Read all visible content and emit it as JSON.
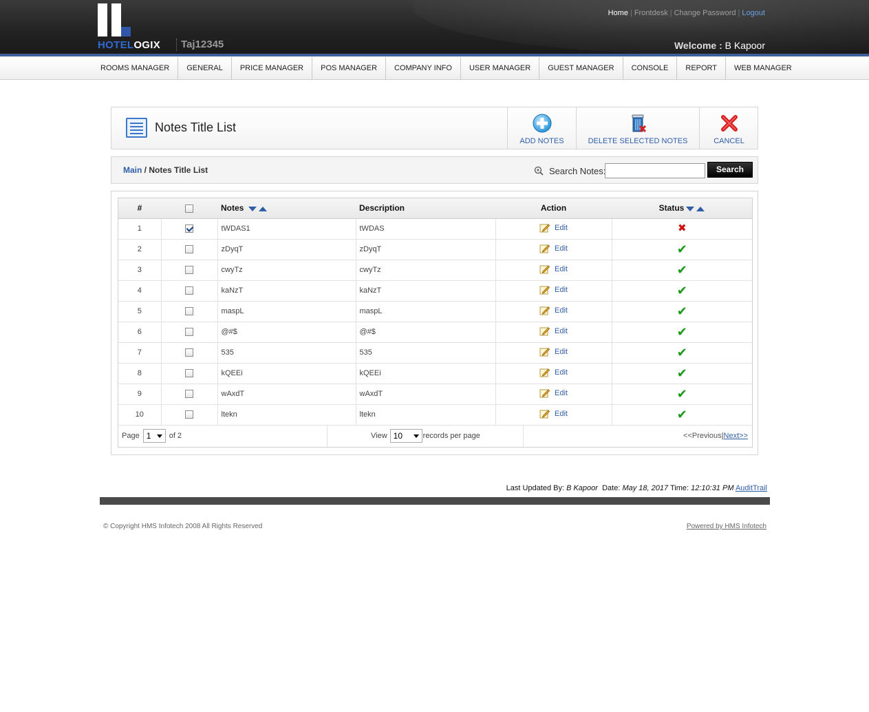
{
  "header": {
    "logo_text_blue": "HOTEL",
    "logo_text_white": "OGIX",
    "hotel_code": "Taj12345",
    "links": {
      "home": "Home",
      "frontdesk": "Frontdesk",
      "change_password": "Change Password",
      "logout": "Logout"
    },
    "welcome_label": "Welcome :",
    "user_name": "B Kapoor"
  },
  "nav": {
    "items": [
      "ROOMS MANAGER",
      "GENERAL",
      "PRICE MANAGER",
      "POS MANAGER",
      "COMPANY INFO",
      "USER MANAGER",
      "GUEST MANAGER",
      "CONSOLE",
      "REPORT",
      "WEB MANAGER"
    ]
  },
  "titlebar": {
    "title": "Notes Title List",
    "add_label": "ADD NOTES",
    "delete_label": "DELETE SELECTED NOTES",
    "cancel_label": "CANCEL"
  },
  "breadcrumb": {
    "main": "Main",
    "separator": " / ",
    "current": "Notes Title List"
  },
  "search": {
    "label": "Search Notes:",
    "value": "",
    "button": "Search"
  },
  "table": {
    "columns": {
      "num": "#",
      "notes": "Notes",
      "description": "Description",
      "action": "Action",
      "status": "Status"
    },
    "edit_label": "Edit",
    "rows": [
      {
        "num": "1",
        "checked": true,
        "notes": "tWDAS1",
        "description": "tWDAS",
        "active": false
      },
      {
        "num": "2",
        "checked": false,
        "notes": "zDyqT",
        "description": "zDyqT",
        "active": true
      },
      {
        "num": "3",
        "checked": false,
        "notes": "cwyTz",
        "description": "cwyTz",
        "active": true
      },
      {
        "num": "4",
        "checked": false,
        "notes": "kaNzT",
        "description": "kaNzT",
        "active": true
      },
      {
        "num": "5",
        "checked": false,
        "notes": "maspL",
        "description": "maspL",
        "active": true
      },
      {
        "num": "6",
        "checked": false,
        "notes": "@#$",
        "description": "@#$",
        "active": true
      },
      {
        "num": "7",
        "checked": false,
        "notes": "535",
        "description": "535",
        "active": true
      },
      {
        "num": "8",
        "checked": false,
        "notes": "kQEEi",
        "description": "kQEEi",
        "active": true
      },
      {
        "num": "9",
        "checked": false,
        "notes": "wAxdT",
        "description": "wAxdT",
        "active": true
      },
      {
        "num": "10",
        "checked": false,
        "notes": "ltekn",
        "description": "ltekn",
        "active": true
      }
    ]
  },
  "pager": {
    "page_label": "Page",
    "page_value": "1",
    "of_label": "of 2",
    "view_label": "View",
    "view_value": "10",
    "records_label": "records per page",
    "previous": "<<Previous",
    "separator": " | ",
    "next": "Next>>"
  },
  "footer": {
    "last_updated_label": "Last Updated By:",
    "last_updated_by": "B Kapoor",
    "date_label": "Date:",
    "date": "May 18, 2017",
    "time_label": "Time:",
    "time": "12:10:31 PM",
    "audit_link": "AuditTrail",
    "copyright": "© Copyright HMS Infotech 2008 All Rights Reserved",
    "powered": "Powered by HMS Infotech"
  },
  "colors": {
    "accent": "#2f5ea8",
    "ok": "#179a16",
    "error": "#cc1111"
  }
}
